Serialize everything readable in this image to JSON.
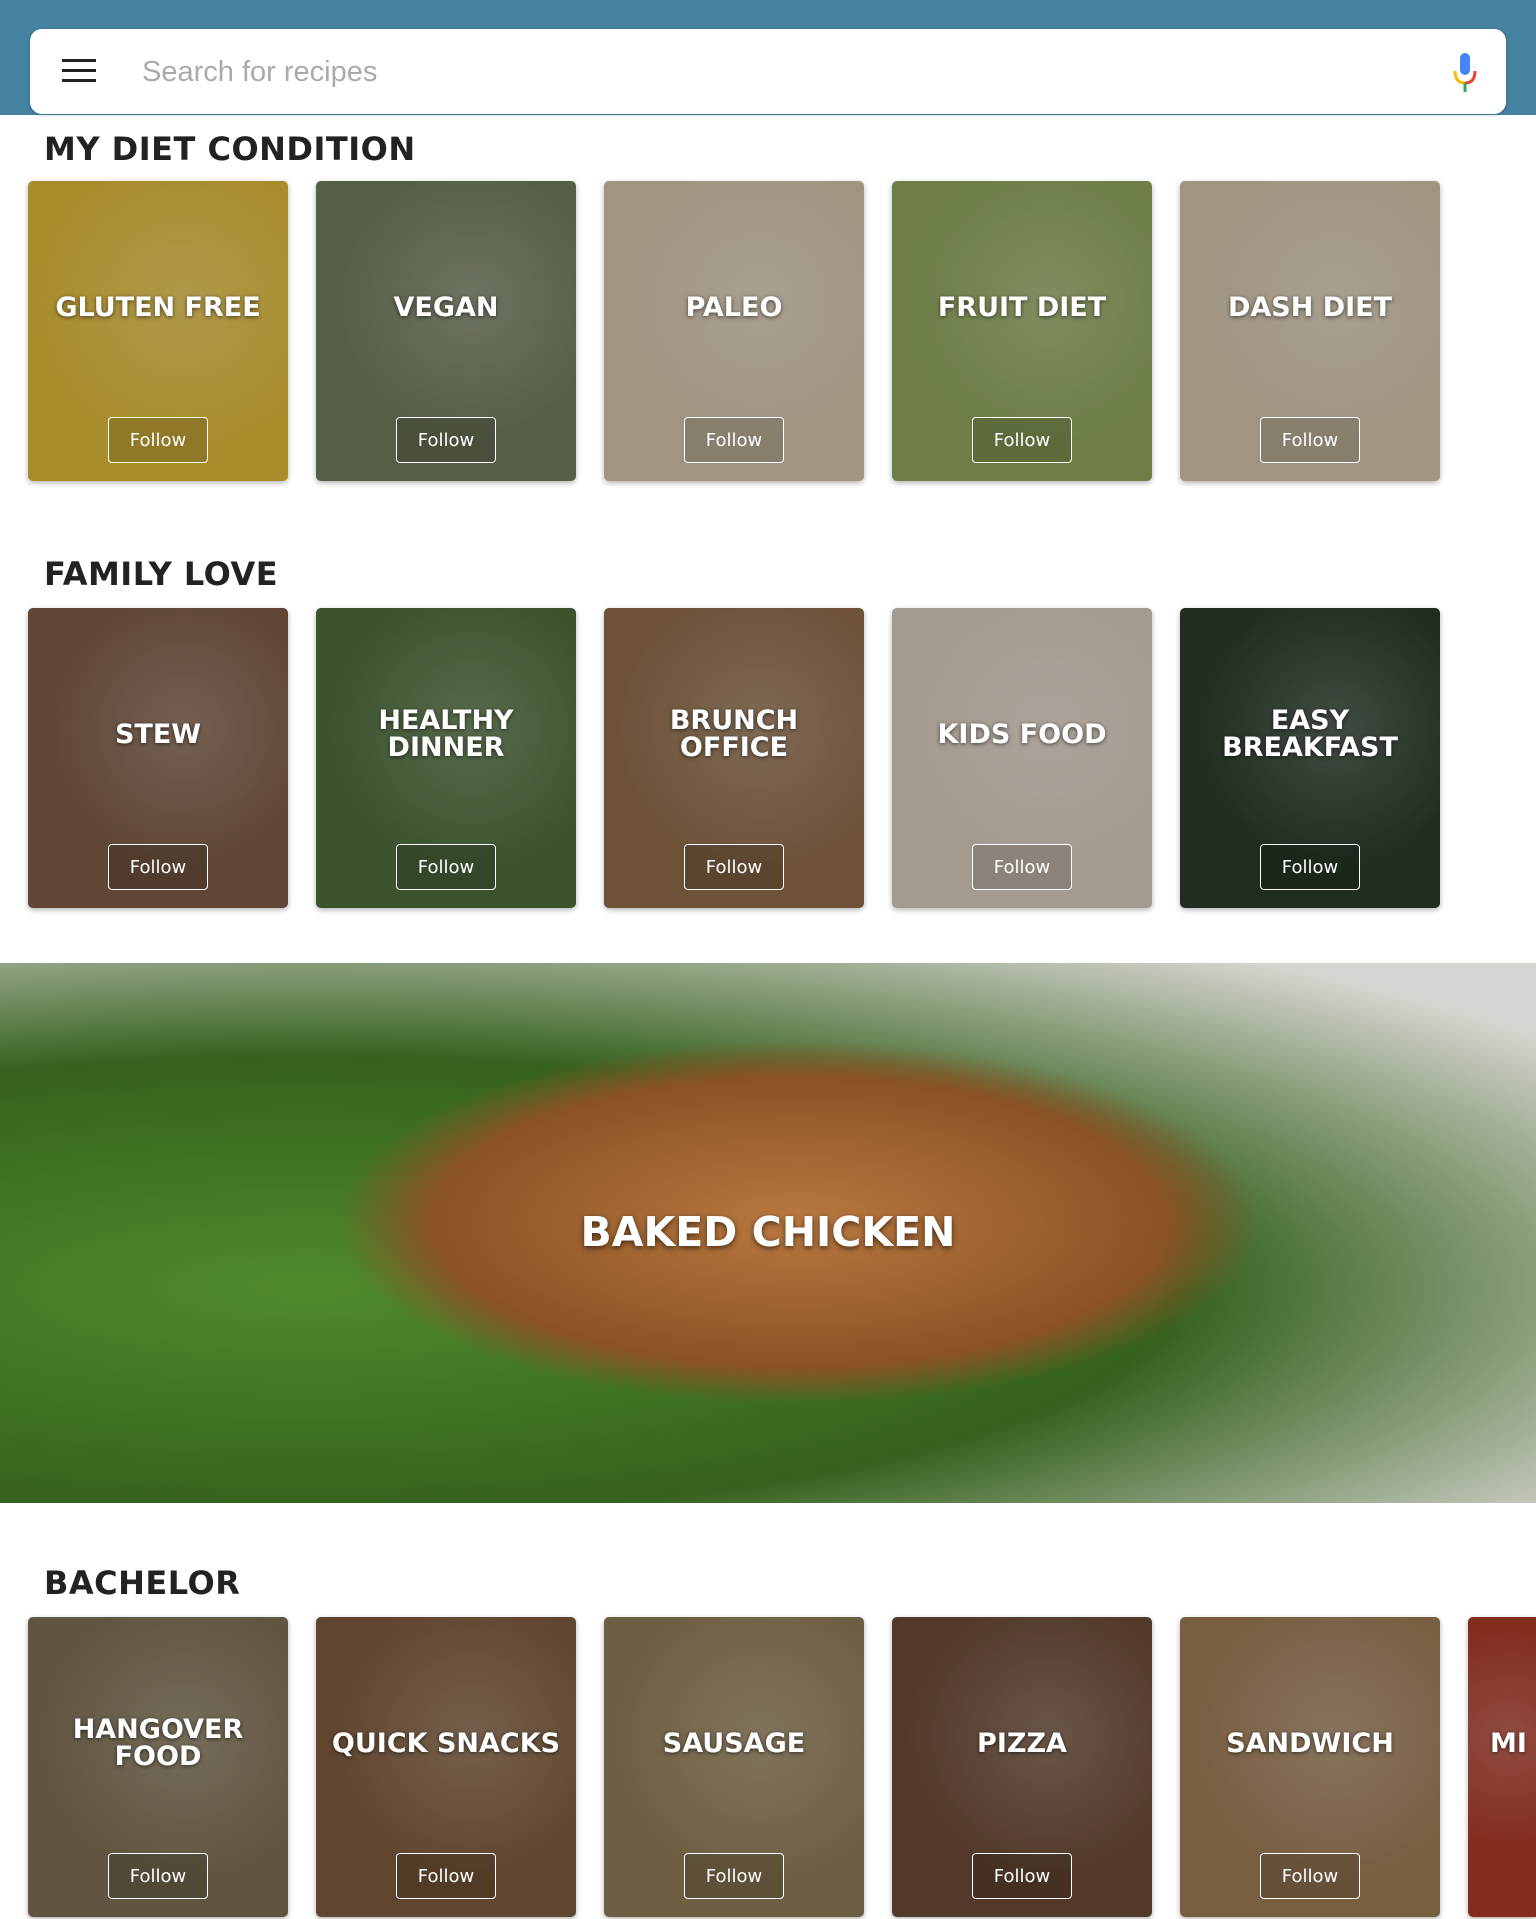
{
  "search": {
    "placeholder": "Search for recipes",
    "menu_icon": "hamburger-menu-icon",
    "mic_icon": "microphone-icon"
  },
  "sections": [
    {
      "title": "MY DIET CONDITION",
      "cards": [
        {
          "label": "GLUTEN FREE",
          "follow": "Follow",
          "color": "#d9b53a"
        },
        {
          "label": "VEGAN",
          "follow": "Follow",
          "color": "#6d7a5a"
        },
        {
          "label": "PALEO",
          "follow": "Follow",
          "color": "#cdbfa5"
        },
        {
          "label": "FRUIT DIET",
          "follow": "Follow",
          "color": "#8da25a"
        },
        {
          "label": "DASH DIET",
          "follow": "Follow",
          "color": "#cdbfa5"
        }
      ]
    },
    {
      "title": "FAMILY LOVE",
      "cards": [
        {
          "label": "STEW",
          "follow": "Follow",
          "color": "#7a5a44"
        },
        {
          "label": "HEALTHY DINNER",
          "follow": "Follow",
          "color": "#4e6b3c"
        },
        {
          "label": "BRUNCH OFFICE",
          "follow": "Follow",
          "color": "#8c6a48"
        },
        {
          "label": "KIDS FOOD",
          "follow": "Follow",
          "color": "#d3c6b8"
        },
        {
          "label": "EASY BREAKFAST",
          "follow": "Follow",
          "color": "#2a3a2a"
        }
      ]
    },
    {
      "title": "BACHELOR",
      "cards": [
        {
          "label": "HANGOVER FOOD",
          "follow": "Follow",
          "color": "#7c6e52"
        },
        {
          "label": "QUICK SNACKS",
          "follow": "Follow",
          "color": "#7c5a3c"
        },
        {
          "label": "SAUSAGE",
          "follow": "Follow",
          "color": "#8f7a55"
        },
        {
          "label": "PIZZA",
          "follow": "Follow",
          "color": "#6a4a36"
        },
        {
          "label": "SANDWICH",
          "follow": "Follow",
          "color": "#9a7a55"
        },
        {
          "label": "MI",
          "follow": "",
          "color": "#a83a28"
        }
      ]
    }
  ],
  "banner": {
    "label": "BAKED CHICKEN"
  }
}
